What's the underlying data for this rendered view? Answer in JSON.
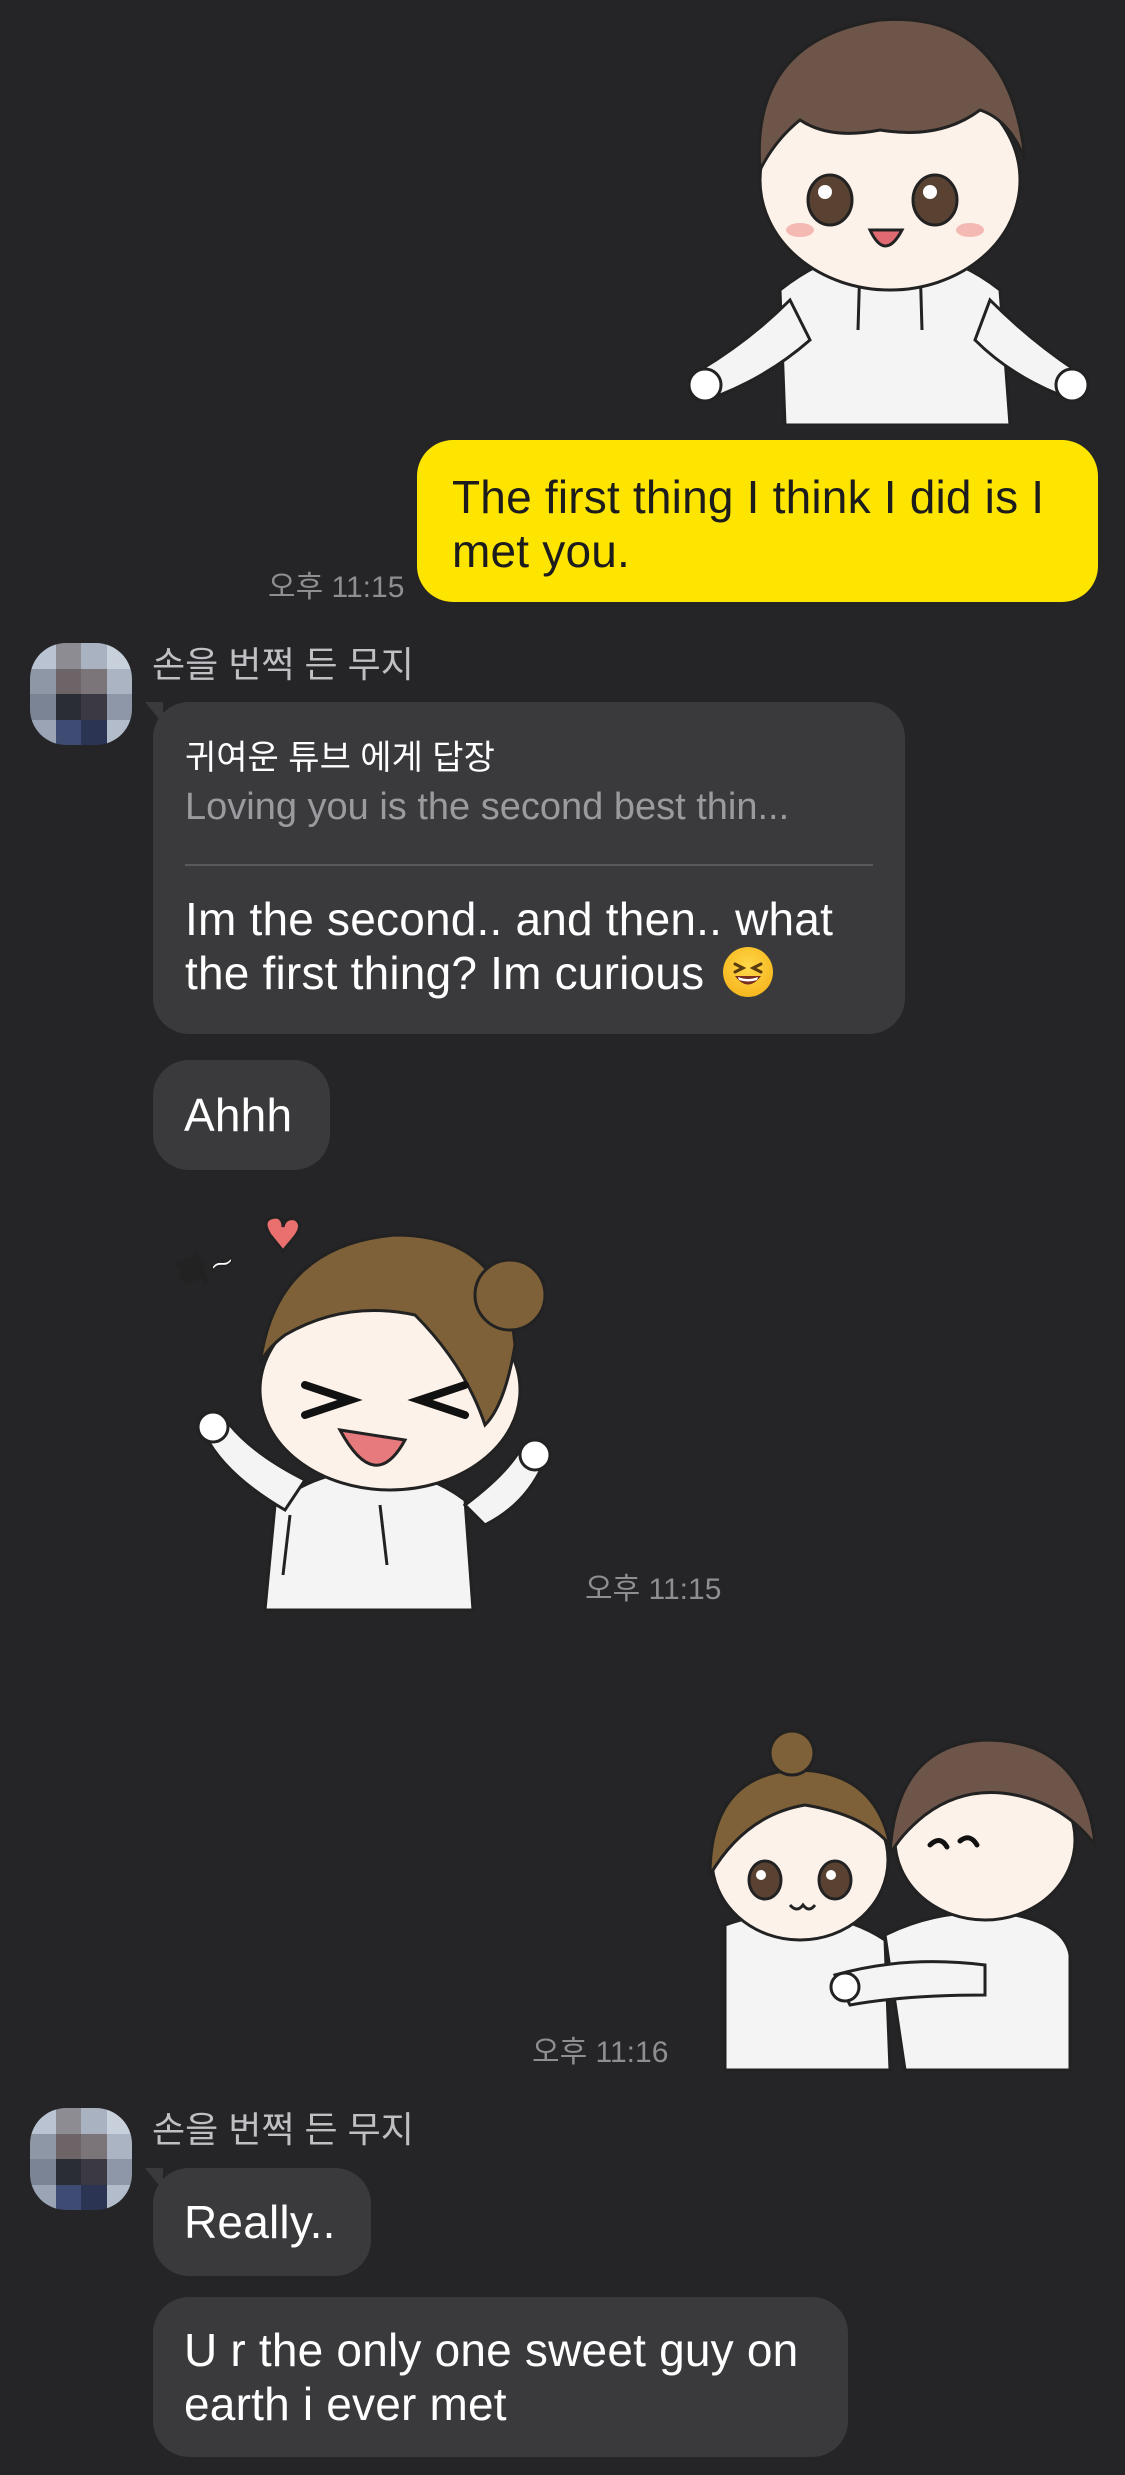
{
  "colors": {
    "background": "#252528",
    "incoming_bubble": "#3a3a3d",
    "outgoing_bubble": "#fee500",
    "timestamp": "#8e8e93"
  },
  "messages": {
    "sticker_boy": {
      "icon": "boy-waving-sticker"
    },
    "out_1": {
      "line1": "The first thing I think I did is I",
      "line2": "met you.",
      "time": "오후 11:15"
    },
    "group_1": {
      "sender": "손을 번쩍 든 무지",
      "reply": {
        "header": "귀여운 튜브 에게 답장",
        "quote": "Loving you is the second best thin...",
        "line1": "Im the second.. and then.. what",
        "line2": "the first thing? Im curious",
        "emoji": "laughing-squinting-face-emoji"
      },
      "ahhh": "Ahhh",
      "sticker_girl": {
        "icon": "girl-cheering-sticker",
        "caption": "꽉~"
      },
      "time": "오후 11:15"
    },
    "sticker_hug": {
      "icon": "couple-hug-sticker",
      "time": "오후 11:16"
    },
    "group_2": {
      "sender": "손을 번쩍 든 무지",
      "really": "Really..",
      "line1": "U r the only one sweet guy on",
      "line2": "earth i ever met"
    }
  }
}
